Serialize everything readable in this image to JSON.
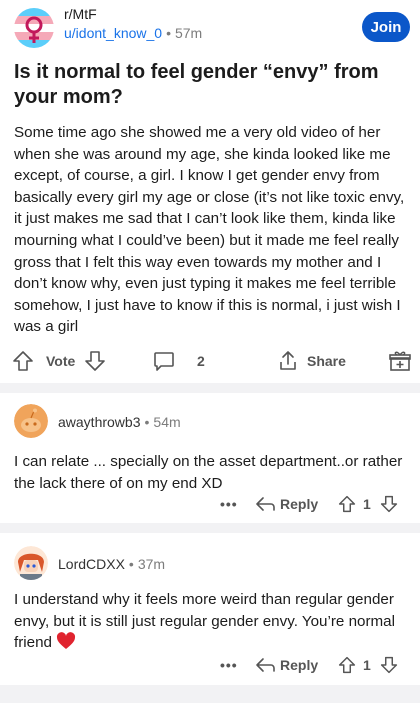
{
  "post": {
    "subreddit": "r/MtF",
    "author": "u/idont_know_0",
    "time": "57m",
    "join_label": "Join",
    "title": "Is it normal to feel gender “envy” from your mom?",
    "body": "Some time ago she showed me a very old video of her when she was around my age, she kinda looked like me except, of course, a girl. I know I get gender envy from basically every girl my age or close (it’s not like toxic envy, it just makes me sad that I can’t look like them, kinda like mourning what I could’ve been) but it made me feel really gross that I felt this way even towards my mother and I don’t know why, even just typing it makes me feel terrible somehow, I just have to know if this is normal, i just wish I was a girl",
    "vote_label": "Vote",
    "comment_count": "2",
    "share_label": "Share"
  },
  "comments": [
    {
      "author": "awaythrowb3",
      "time": "54m",
      "text": "I can relate ... specially on the asset department..or rather the lack there of on my end XD",
      "more_label": "•••",
      "reply_label": "Reply",
      "score": "1"
    },
    {
      "author": "LordCDXX",
      "time": "37m",
      "text": "I understand why it feels more weird than regular gender envy, but it is still just regular gender envy. You’re normal friend",
      "more_label": "•••",
      "reply_label": "Reply",
      "score": "1"
    }
  ],
  "colors": {
    "accent": "#0b57c9",
    "link": "#1a73e8",
    "muted": "#7c7c7c",
    "separator": "#f2f2f4",
    "heart": "#e0242f"
  },
  "icons": {
    "upvote": "arrow-up-outline",
    "downvote": "arrow-down-outline",
    "comments": "speech-bubble",
    "share": "share-upload",
    "award": "gift-box",
    "reply": "reply-arrow",
    "more": "ellipsis"
  }
}
